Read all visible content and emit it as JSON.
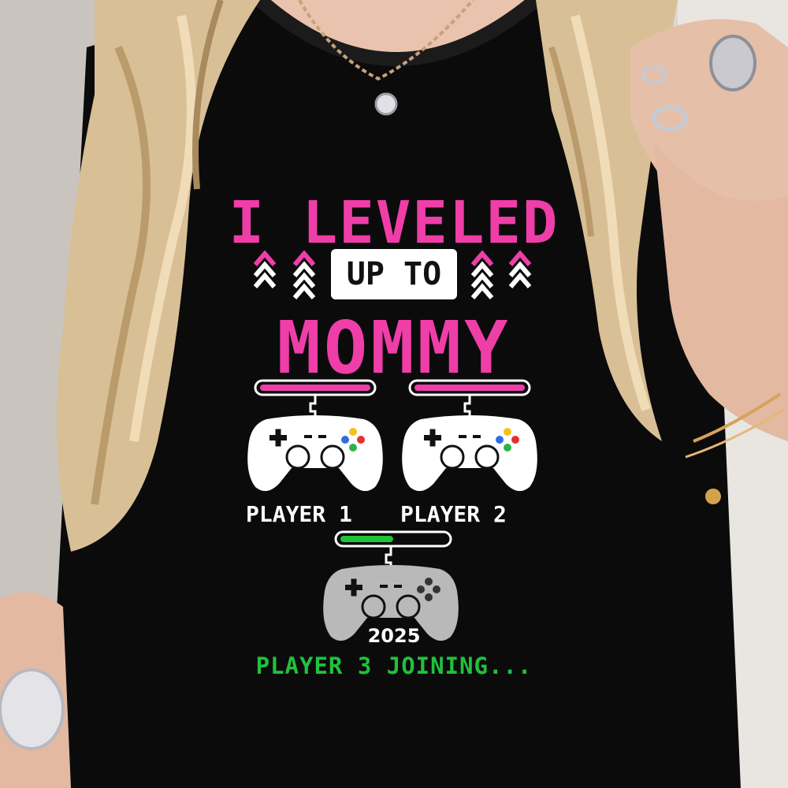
{
  "design": {
    "line1": "I LEVELED",
    "line2": "UP TO",
    "line3": "MOMMY",
    "player1_label": "PLAYER 1",
    "player2_label": "PLAYER 2",
    "year": "2025",
    "player3_label": "PLAYER 3 JOINING..."
  },
  "progress": {
    "player1_fill": 1.0,
    "player2_fill": 1.0,
    "player3_fill": 0.5
  },
  "colors": {
    "shirt": "#0b0b0c",
    "pink": "#ef3ea8",
    "green": "#1fc23a",
    "white": "#ffffff",
    "gray_controller": "#b9b9b9",
    "hair": "#d8bf95",
    "skin": "#e9c3ad",
    "background": "#d9d3cc"
  },
  "icons": [
    "game-controller-icon",
    "double-chevron-up-icon",
    "necklace-pendant-icon"
  ]
}
